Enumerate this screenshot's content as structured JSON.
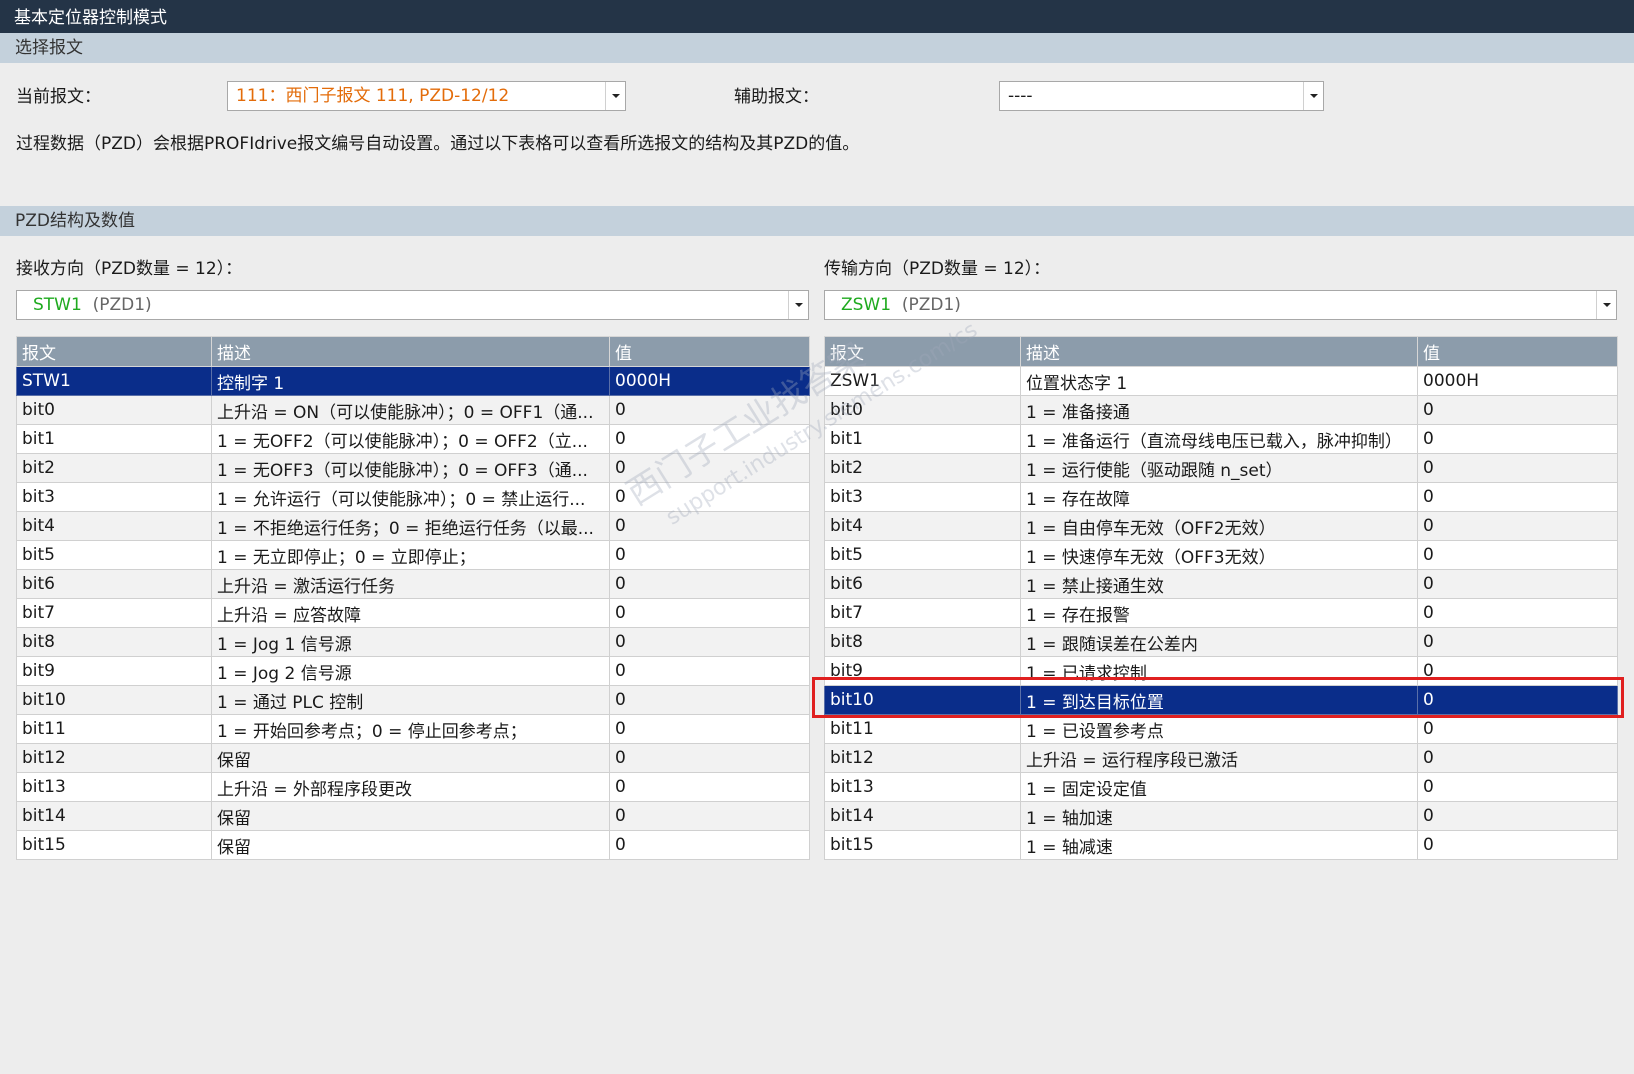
{
  "window": {
    "title": "基本定位器控制模式"
  },
  "telegram_section": {
    "header": "选择报文",
    "current_label": "当前报文：",
    "current_value": "111：西门子报文 111, PZD-12/12",
    "aux_label": "辅助报文：",
    "aux_value": "----",
    "info_text": "过程数据（PZD）会根据PROFIdrive报文编号自动设置。通过以下表格可以查看所选报文的结构及其PZD的值。"
  },
  "pzd_section": {
    "header": "PZD结构及数值",
    "receive": {
      "label": "接收方向（PZD数量 = 12）：",
      "combo_name": "STW1",
      "combo_suffix": "(PZD1)",
      "columns": [
        "报文",
        "描述",
        "值"
      ],
      "rows": [
        [
          "STW1",
          "控制字 1",
          "0000H"
        ],
        [
          "bit0",
          "上升沿 = ON（可以使能脉冲）；0 = OFF1（通...",
          "0"
        ],
        [
          "bit1",
          "1 = 无OFF2（可以使能脉冲）；0 = OFF2（立...",
          "0"
        ],
        [
          "bit2",
          "1 = 无OFF3（可以使能脉冲）；0 = OFF3（通...",
          "0"
        ],
        [
          "bit3",
          "1 = 允许运行（可以使能脉冲）；0 = 禁止运行...",
          "0"
        ],
        [
          "bit4",
          "1 = 不拒绝运行任务；0 = 拒绝运行任务（以最...",
          "0"
        ],
        [
          "bit5",
          "1 = 无立即停止；0 = 立即停止；",
          "0"
        ],
        [
          "bit6",
          "上升沿 = 激活运行任务",
          "0"
        ],
        [
          "bit7",
          "上升沿 = 应答故障",
          "0"
        ],
        [
          "bit8",
          "1 = Jog 1 信号源",
          "0"
        ],
        [
          "bit9",
          "1 = Jog 2 信号源",
          "0"
        ],
        [
          "bit10",
          "1 = 通过 PLC 控制",
          "0"
        ],
        [
          "bit11",
          "1 = 开始回参考点；0 = 停止回参考点；",
          "0"
        ],
        [
          "bit12",
          "保留",
          "0"
        ],
        [
          "bit13",
          "上升沿 = 外部程序段更改",
          "0"
        ],
        [
          "bit14",
          "保留",
          "0"
        ],
        [
          "bit15",
          "保留",
          "0"
        ]
      ],
      "selected_row": 0
    },
    "transmit": {
      "label": "传输方向（PZD数量 = 12）：",
      "combo_name": "ZSW1",
      "combo_suffix": "(PZD1)",
      "columns": [
        "报文",
        "描述",
        "值"
      ],
      "rows": [
        [
          "ZSW1",
          "位置状态字 1",
          "0000H"
        ],
        [
          "bit0",
          "1 = 准备接通",
          "0"
        ],
        [
          "bit1",
          "1 = 准备运行（直流母线电压已载入，脉冲抑制）",
          "0"
        ],
        [
          "bit2",
          "1 = 运行使能（驱动跟随 n_set）",
          "0"
        ],
        [
          "bit3",
          "1 = 存在故障",
          "0"
        ],
        [
          "bit4",
          "1 = 自由停车无效（OFF2无效）",
          "0"
        ],
        [
          "bit5",
          "1 = 快速停车无效（OFF3无效）",
          "0"
        ],
        [
          "bit6",
          "1 = 禁止接通生效",
          "0"
        ],
        [
          "bit7",
          "1 = 存在报警",
          "0"
        ],
        [
          "bit8",
          "1 = 跟随误差在公差内",
          "0"
        ],
        [
          "bit9",
          "1 = 已请求控制",
          "0"
        ],
        [
          "bit10",
          "1 = 到达目标位置",
          "0"
        ],
        [
          "bit11",
          "1 = 已设置参考点",
          "0"
        ],
        [
          "bit12",
          "上升沿 = 运行程序段已激活",
          "0"
        ],
        [
          "bit13",
          "1 = 固定设定值",
          "0"
        ],
        [
          "bit14",
          "1 = 轴加速",
          "0"
        ],
        [
          "bit15",
          "1 = 轴减速",
          "0"
        ]
      ],
      "selected_row": 11
    }
  },
  "watermark": {
    "line1": "西门子工业找答案",
    "line2": "support.industry.siemens.com/cs"
  },
  "colors": {
    "title_bar": "#243447",
    "section_header": "#c4d1dc",
    "table_header": "#8c9cab",
    "selected_row": "#0a2d8a",
    "highlight": "#e02020",
    "current_telegram_text": "#e36c0a",
    "combo_name_text": "#1faa1f"
  }
}
